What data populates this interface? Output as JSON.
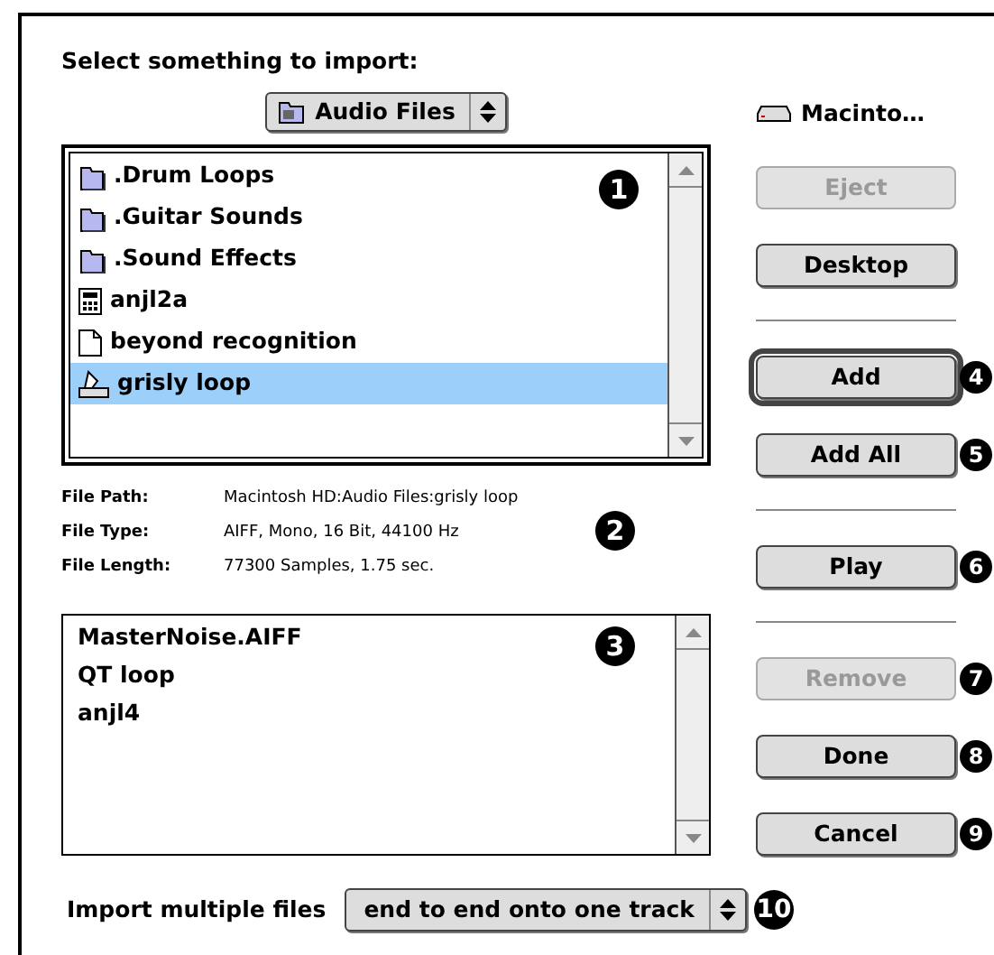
{
  "dialog": {
    "title": "Select something to import:",
    "folder_popup": {
      "label": "Audio Files"
    },
    "volume": {
      "label": "Macinto…"
    },
    "file_list": {
      "callout": "1",
      "items": [
        {
          "name": ".Drum Loops",
          "kind": "folder",
          "selected": false
        },
        {
          "name": ".Guitar Sounds",
          "kind": "folder",
          "selected": false
        },
        {
          "name": ".Sound Effects",
          "kind": "folder",
          "selected": false
        },
        {
          "name": "anjl2a",
          "kind": "application",
          "selected": false
        },
        {
          "name": "beyond recognition",
          "kind": "document",
          "selected": false
        },
        {
          "name": "grisly loop",
          "kind": "sound",
          "selected": true
        }
      ]
    },
    "file_info": {
      "callout": "2",
      "rows": [
        {
          "label": "File Path:",
          "value": "Macintosh HD:Audio Files:grisly loop"
        },
        {
          "label": "File Type:",
          "value": "AIFF, Mono, 16 Bit, 44100 Hz"
        },
        {
          "label": "File Length:",
          "value": "77300 Samples, 1.75 sec."
        }
      ]
    },
    "import_list": {
      "callout": "3",
      "items": [
        "MasterNoise.AIFF",
        "QT loop",
        "anjl4"
      ]
    },
    "buttons": [
      {
        "label": "Eject",
        "disabled": true,
        "default": false,
        "separator_before": false
      },
      {
        "label": "Desktop",
        "disabled": false,
        "default": false,
        "separator_before": false
      },
      {
        "label": "Add",
        "disabled": false,
        "default": true,
        "separator_before": true,
        "callout": "4"
      },
      {
        "label": "Add All",
        "disabled": false,
        "default": false,
        "separator_before": false,
        "callout": "5"
      },
      {
        "label": "Play",
        "disabled": false,
        "default": false,
        "separator_before": true,
        "callout": "6"
      },
      {
        "label": "Remove",
        "disabled": true,
        "default": false,
        "separator_before": true,
        "callout": "7"
      },
      {
        "label": "Done",
        "disabled": false,
        "default": false,
        "separator_before": false,
        "callout": "8"
      },
      {
        "label": "Cancel",
        "disabled": false,
        "default": false,
        "separator_before": false,
        "callout": "9"
      }
    ],
    "import_multiple": {
      "label": "Import multiple files",
      "value": "end to end onto one track",
      "callout": "10"
    }
  }
}
